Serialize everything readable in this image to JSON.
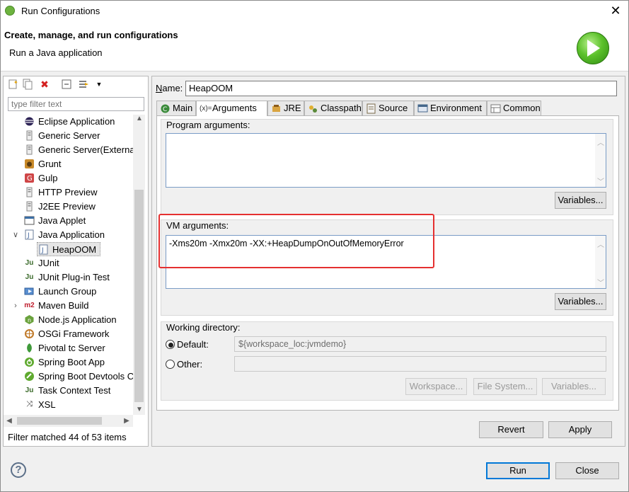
{
  "window": {
    "title": "Run Configurations",
    "close_glyph": "✕"
  },
  "banner": {
    "title": "Create, manage, and run configurations",
    "subtitle": "Run a Java application"
  },
  "left": {
    "filter_placeholder": "type filter text",
    "tree": [
      {
        "label": "Eclipse Application",
        "icon": "eclipse-icon"
      },
      {
        "label": "Generic Server",
        "icon": "server-icon"
      },
      {
        "label": "Generic Server(External",
        "icon": "server-icon"
      },
      {
        "label": "Grunt",
        "icon": "grunt-icon"
      },
      {
        "label": "Gulp",
        "icon": "gulp-icon"
      },
      {
        "label": "HTTP Preview",
        "icon": "server-icon"
      },
      {
        "label": "J2EE Preview",
        "icon": "server-icon"
      },
      {
        "label": "Java Applet",
        "icon": "applet-icon"
      },
      {
        "label": "Java Application",
        "icon": "java-app-icon",
        "expanded": true
      },
      {
        "label": "HeapOOM",
        "icon": "java-app-icon",
        "child": true,
        "selected": true
      },
      {
        "label": "JUnit",
        "icon": "junit-icon"
      },
      {
        "label": "JUnit Plug-in Test",
        "icon": "junit-plugin-icon"
      },
      {
        "label": "Launch Group",
        "icon": "launch-group-icon"
      },
      {
        "label": "Maven Build",
        "icon": "maven-icon",
        "collapsed": true
      },
      {
        "label": "Node.js Application",
        "icon": "nodejs-icon"
      },
      {
        "label": "OSGi Framework",
        "icon": "osgi-icon"
      },
      {
        "label": "Pivotal tc Server",
        "icon": "pivotal-icon"
      },
      {
        "label": "Spring Boot App",
        "icon": "spring-boot-icon"
      },
      {
        "label": "Spring Boot Devtools C",
        "icon": "spring-devtools-icon"
      },
      {
        "label": "Task Context Test",
        "icon": "task-context-icon"
      },
      {
        "label": "XSL",
        "icon": "xsl-icon"
      }
    ],
    "status": "Filter matched 44 of 53 items"
  },
  "right": {
    "name_label": "Name:",
    "name_value": "HeapOOM",
    "tabs": [
      {
        "label": "Main",
        "icon": "main-icon"
      },
      {
        "label": "Arguments",
        "icon": "arguments-icon",
        "active": true
      },
      {
        "label": "JRE",
        "icon": "jre-icon"
      },
      {
        "label": "Classpath",
        "icon": "classpath-icon"
      },
      {
        "label": "Source",
        "icon": "source-icon"
      },
      {
        "label": "Environment",
        "icon": "environment-icon"
      },
      {
        "label": "Common",
        "icon": "common-icon"
      }
    ],
    "program_args_label": "Program arguments:",
    "program_args_value": "",
    "variables_label": "Variables...",
    "vm_args_label": "VM arguments:",
    "vm_args_value": "-Xms20m -Xmx20m -XX:+HeapDumpOnOutOfMemoryError",
    "working_dir_label": "Working directory:",
    "default_label": "Default:",
    "default_value": "${workspace_loc:jvmdemo}",
    "other_label": "Other:",
    "workspace_btn": "Workspace...",
    "filesystem_btn": "File System...",
    "variables_btn": "Variables...",
    "revert_btn": "Revert",
    "apply_btn": "Apply"
  },
  "footer": {
    "run_btn": "Run",
    "close_btn": "Close"
  },
  "colors": {
    "highlight": "#e53030",
    "accent": "#0078d7"
  }
}
